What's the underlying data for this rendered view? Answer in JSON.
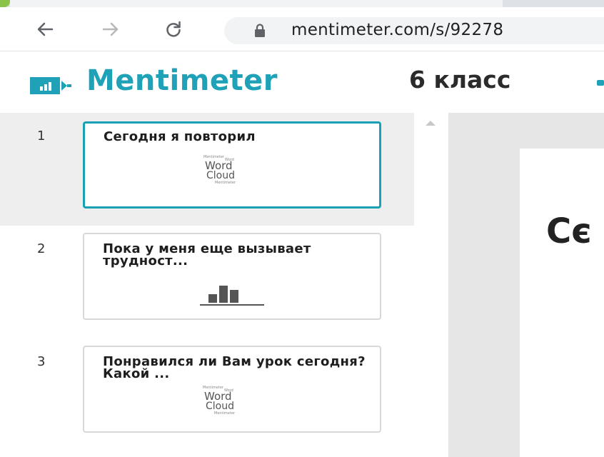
{
  "browser": {
    "url": "mentimeter.com/s/92278",
    "back_icon": "arrow-left-icon",
    "forward_icon": "arrow-right-icon",
    "reload_icon": "reload-icon",
    "lock_icon": "lock-icon"
  },
  "app": {
    "logo_text": "Mentimeter",
    "presentation_title": "6 класс",
    "accent_color": "#1fa2b8"
  },
  "slides": [
    {
      "number": "1",
      "title": "Сегодня я повторил",
      "type": "word-cloud",
      "active": true
    },
    {
      "number": "2",
      "title": "Пока у меня еще вызывает трудност...",
      "type": "bar-chart",
      "active": false
    },
    {
      "number": "3",
      "title": "Понравился ли Вам урок сегодня? Какой ...",
      "type": "word-cloud",
      "active": false
    }
  ],
  "word_cloud_thumb": {
    "word": "Word",
    "cloud": "Cloud",
    "tiny_top": "Mentimeter",
    "tiny_small": "Word",
    "tiny_bottom": "Mentimeter",
    "tiny_side": "Word"
  },
  "preview": {
    "text": "Сє"
  }
}
